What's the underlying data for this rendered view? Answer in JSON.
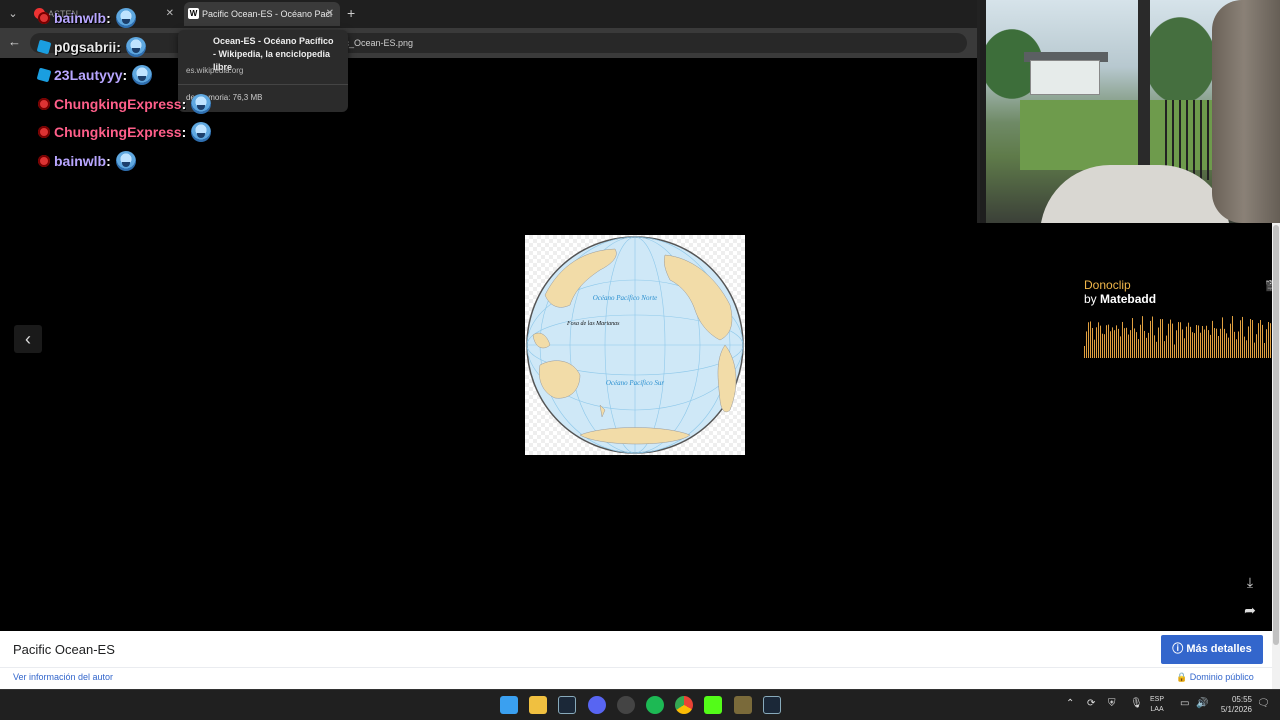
{
  "browser": {
    "tabs": [
      {
        "label": "ASTEN",
        "active": false
      },
      {
        "label": "Pacific Ocean-ES - Océano Paci",
        "active": true
      }
    ],
    "back_icon": "arrow-left-icon",
    "url": "fic_Ocean-ES.png",
    "hover_card": {
      "title": "Ocean-ES - Océano Pacífico - Wikipedia, la enciclopedia libre",
      "domain": "es.wikipedia.org",
      "memory": "de memoria: 76,3 MB"
    }
  },
  "chat": [
    {
      "user": "bainwlb",
      "color": "#b8a6ff",
      "badge": "red"
    },
    {
      "user": "p0gsabrii",
      "color": "#e8e8e8",
      "badge": "cube"
    },
    {
      "user": "23Lautyyy",
      "color": "#b8a6ff",
      "badge": "cube"
    },
    {
      "user": "ChungkingExpress",
      "color": "#ff5f8a",
      "badge": "red"
    },
    {
      "user": "ChungkingExpress",
      "color": "#ff5f8a",
      "badge": "red"
    },
    {
      "user": "bainwlb",
      "color": "#b8a6ff",
      "badge": "red"
    }
  ],
  "map": {
    "north_label": "Océano Pacífico Norte",
    "south_label": "Océano Pacífico Sur",
    "trench_label": "Fosa de las Marianas"
  },
  "donoclip": {
    "title": "Donoclip",
    "by_prefix": "by",
    "author": "Matebadd",
    "wave_color": "#e0a040"
  },
  "info": {
    "title": "Pacific Ocean-ES",
    "author_link": "Ver información del autor",
    "more_button": "Más detalles",
    "license": "Dominio público",
    "accent": "#3366cc"
  },
  "taskbar": {
    "lang_top": "ESP",
    "lang_bottom": "LAA",
    "time": "05:55",
    "date": "5/1/2026"
  }
}
